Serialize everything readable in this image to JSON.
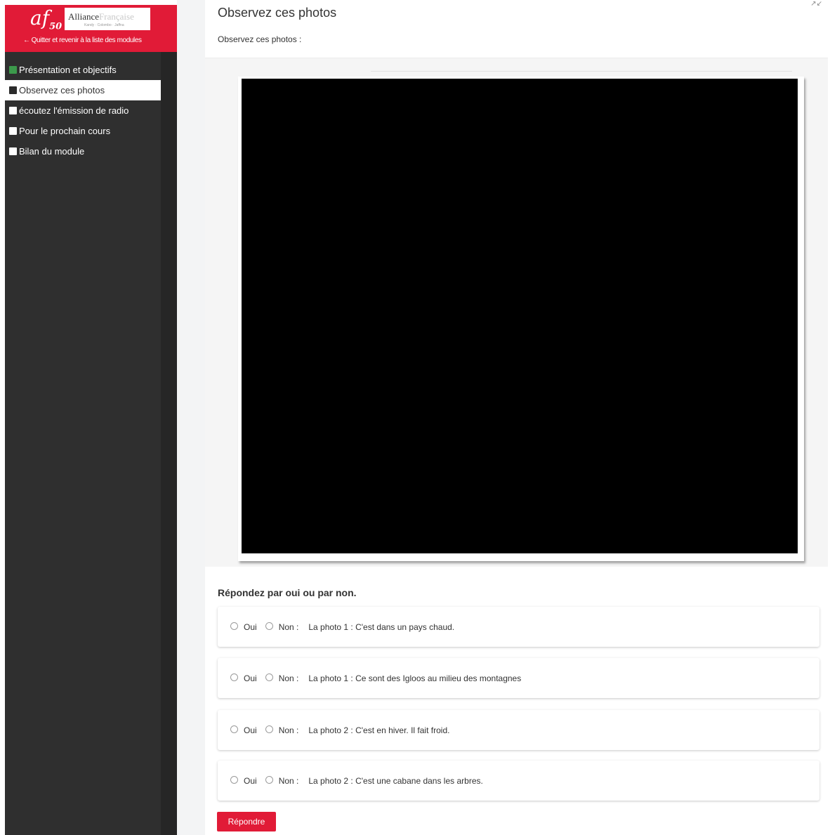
{
  "sidebar": {
    "logo": {
      "mark": "af",
      "mark_number": "50",
      "brand_name_part1": "Alliance",
      "brand_name_part2": "Française",
      "brand_tagline": "Kandy · Colombo · Jaffna"
    },
    "quit_link": "Quitter et revenir à la liste des modules",
    "items": [
      {
        "label": "Présentation et objectifs",
        "status": "completed"
      },
      {
        "label": "Observez ces photos",
        "status": "current"
      },
      {
        "label": "écoutez l'émission de radio",
        "status": "not-started"
      },
      {
        "label": "Pour le prochain cours",
        "status": "not-started"
      },
      {
        "label": "Bilan du module",
        "status": "not-started"
      }
    ]
  },
  "header": {
    "title": "Observez ces photos",
    "subtitle": "Observez ces photos :"
  },
  "quiz": {
    "heading": "Répondez par oui ou par non.",
    "yes_label": "Oui",
    "no_label": "Non :",
    "questions": [
      {
        "text": "La photo 1 : C'est dans un pays chaud."
      },
      {
        "text": "La photo 1 : Ce sont des Igloos au milieu des montagnes"
      },
      {
        "text": "La photo 2 : C'est en hiver. Il fait froid."
      },
      {
        "text": "La photo 2 : C'est une cabane dans les arbres."
      }
    ],
    "submit_label": "Répondre"
  },
  "colors": {
    "brand_red": "#e11b37",
    "sidebar_bg": "#2f2f2f",
    "completed_green": "#3c9a4b"
  }
}
